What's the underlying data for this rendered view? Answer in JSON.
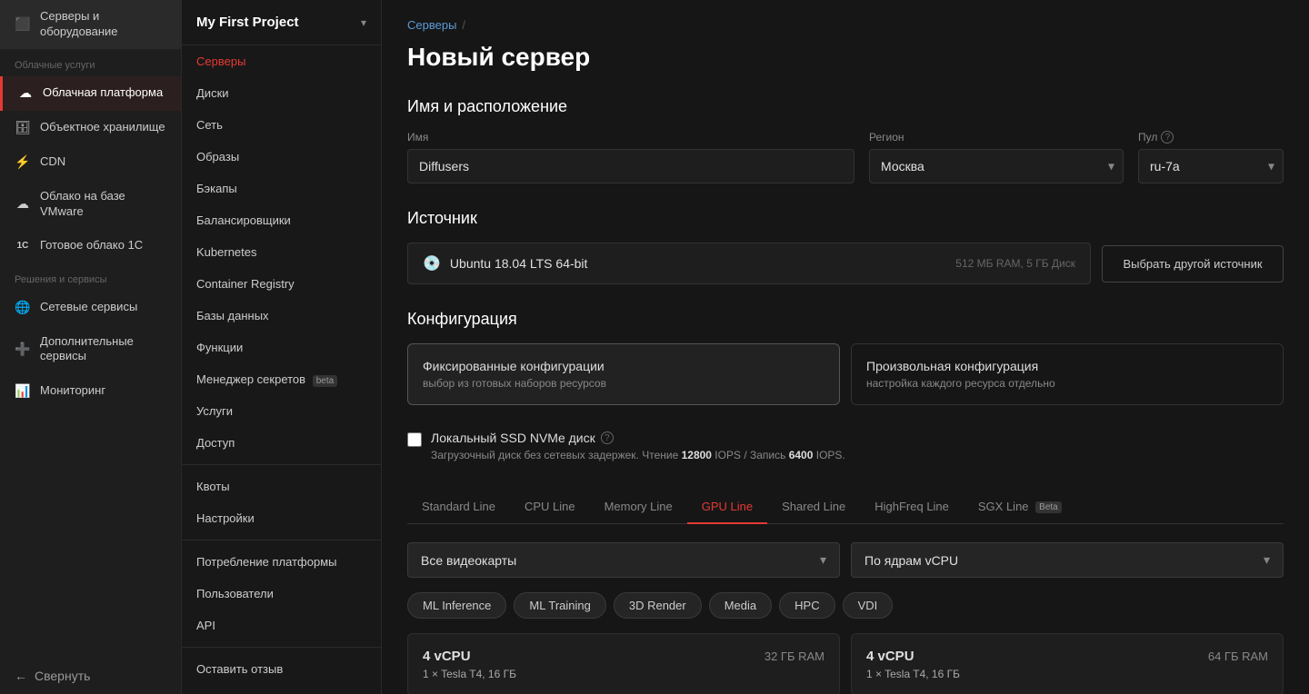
{
  "sidebar": {
    "sections": [
      {
        "title": "",
        "items": [
          {
            "id": "servers",
            "label": "Серверы и оборудование",
            "icon": "⬜",
            "active": false
          }
        ]
      },
      {
        "title": "Облачные услуги",
        "items": [
          {
            "id": "cloud-platform",
            "label": "Облачная платформа",
            "icon": "☁",
            "active": true
          },
          {
            "id": "object-storage",
            "label": "Объектное хранилище",
            "icon": "🗄",
            "active": false
          },
          {
            "id": "cdn",
            "label": "CDN",
            "icon": "⚡",
            "active": false
          },
          {
            "id": "vmware-cloud",
            "label": "Облако на базе VMware",
            "icon": "☁",
            "active": false
          },
          {
            "id": "1c-cloud",
            "label": "Готовое облако 1С",
            "icon": "1С",
            "active": false
          }
        ]
      },
      {
        "title": "Решения и сервисы",
        "items": [
          {
            "id": "network-services",
            "label": "Сетевые сервисы",
            "icon": "🌐",
            "active": false
          },
          {
            "id": "extra-services",
            "label": "Дополнительные сервисы",
            "icon": "➕",
            "active": false
          },
          {
            "id": "monitoring",
            "label": "Мониторинг",
            "icon": "📊",
            "active": false
          }
        ]
      }
    ],
    "collapse_label": "Свернуть"
  },
  "project": {
    "title": "My First Project",
    "nav_items": [
      {
        "id": "servers",
        "label": "Серверы",
        "active": true
      },
      {
        "id": "disks",
        "label": "Диски",
        "active": false
      },
      {
        "id": "network",
        "label": "Сеть",
        "active": false
      },
      {
        "id": "images",
        "label": "Образы",
        "active": false
      },
      {
        "id": "backups",
        "label": "Бэкапы",
        "active": false
      },
      {
        "id": "balancers",
        "label": "Балансировщики",
        "active": false
      },
      {
        "id": "kubernetes",
        "label": "Kubernetes",
        "active": false
      },
      {
        "id": "container-registry",
        "label": "Container Registry",
        "active": false
      },
      {
        "id": "databases",
        "label": "Базы данных",
        "active": false
      },
      {
        "id": "functions",
        "label": "Функции",
        "active": false
      },
      {
        "id": "secrets-manager",
        "label": "Менеджер секретов",
        "active": false,
        "badge": "beta"
      },
      {
        "id": "services",
        "label": "Услуги",
        "active": false
      },
      {
        "id": "access",
        "label": "Доступ",
        "active": false
      }
    ],
    "bottom_items": [
      {
        "id": "quotas",
        "label": "Квоты"
      },
      {
        "id": "settings",
        "label": "Настройки"
      }
    ],
    "extra_items": [
      {
        "id": "platform-usage",
        "label": "Потребление платформы"
      },
      {
        "id": "users",
        "label": "Пользователи"
      },
      {
        "id": "api",
        "label": "API"
      }
    ],
    "leave_feedback": "Оставить отзыв"
  },
  "main": {
    "breadcrumb": {
      "parent": "Серверы",
      "separator": "/",
      "current": ""
    },
    "page_title": "Новый сервер",
    "sections": {
      "name_location": {
        "title": "Имя и расположение",
        "name_label": "Имя",
        "name_value": "Diffusers",
        "name_placeholder": "Diffusers",
        "region_label": "Регион",
        "region_value": "Москва",
        "pool_label": "Пул",
        "pool_help": "?",
        "pool_value": "ru-7a"
      },
      "source": {
        "title": "Источник",
        "os_name": "Ubuntu 18.04 LTS 64-bit",
        "os_meta": "512 МБ RAM, 5 ГБ Диск",
        "btn_label": "Выбрать другой источник"
      },
      "config": {
        "title": "Конфигурация",
        "card1_title": "Фиксированные конфигурации",
        "card1_desc": "выбор из готовых наборов ресурсов",
        "card2_title": "Произвольная конфигурация",
        "card2_desc": "настройка каждого ресурса отдельно",
        "checkbox_label": "Локальный SSD NVMe диск",
        "checkbox_desc": "Загрузочный диск без сетевых задержек. Чтение ",
        "iops_read": "12800",
        "iops_read_suffix": " IOPS / Запись ",
        "iops_write": "6400",
        "iops_write_suffix": " IOPS."
      },
      "lines": {
        "tabs": [
          {
            "id": "standard",
            "label": "Standard Line",
            "active": false
          },
          {
            "id": "cpu",
            "label": "CPU Line",
            "active": false
          },
          {
            "id": "memory",
            "label": "Memory Line",
            "active": false
          },
          {
            "id": "gpu",
            "label": "GPU Line",
            "active": true
          },
          {
            "id": "shared",
            "label": "Shared Line",
            "active": false
          },
          {
            "id": "highfreq",
            "label": "HighFreq Line",
            "active": false
          },
          {
            "id": "sgx",
            "label": "SGX Line",
            "active": false,
            "badge": "Beta"
          }
        ],
        "gpu_filter_label": "Все видеокарты",
        "sort_label": "По ядрам vCPU",
        "tag_filters": [
          {
            "id": "ml-inference",
            "label": "ML Inference",
            "active": false
          },
          {
            "id": "ml-training",
            "label": "ML Training",
            "active": false
          },
          {
            "id": "3d-render",
            "label": "3D Render",
            "active": false
          },
          {
            "id": "media",
            "label": "Media",
            "active": false
          },
          {
            "id": "hpc",
            "label": "HPC",
            "active": false
          },
          {
            "id": "vdi",
            "label": "VDI",
            "active": false
          }
        ],
        "server_cards": [
          {
            "cpu": "4 vCPU",
            "ram": "32 ГБ RAM",
            "gpu_line1": "1 × Tesla T4, 16 ГБ"
          },
          {
            "cpu": "4 vCPU",
            "ram": "64 ГБ RAM",
            "gpu_line1": "1 × Tesla T4, 16 ГБ"
          }
        ]
      }
    }
  }
}
